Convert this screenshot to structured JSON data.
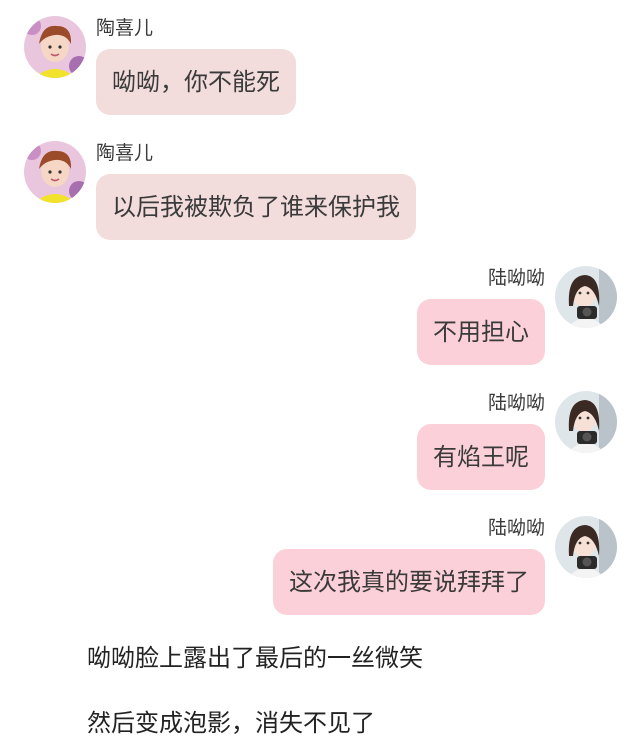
{
  "messages": [
    {
      "side": "left",
      "sender": "陶喜儿",
      "text": "呦呦，你不能死",
      "avatar": "taoxier-avatar"
    },
    {
      "side": "left",
      "sender": "陶喜儿",
      "text": "以后我被欺负了谁来保护我",
      "avatar": "taoxier-avatar"
    },
    {
      "side": "right",
      "sender": "陆呦呦",
      "text": "不用担心",
      "avatar": "luyouyou-avatar"
    },
    {
      "side": "right",
      "sender": "陆呦呦",
      "text": "有焰王呢",
      "avatar": "luyouyou-avatar"
    },
    {
      "side": "right",
      "sender": "陆呦呦",
      "text": "这次我真的要说拜拜了",
      "avatar": "luyouyou-avatar"
    }
  ],
  "narration": [
    "呦呦脸上露出了最后的一丝微笑",
    "然后变成泡影，消失不见了"
  ],
  "colors": {
    "left_bubble": "#f3dcdc",
    "right_bubble": "#fbd0d9"
  }
}
